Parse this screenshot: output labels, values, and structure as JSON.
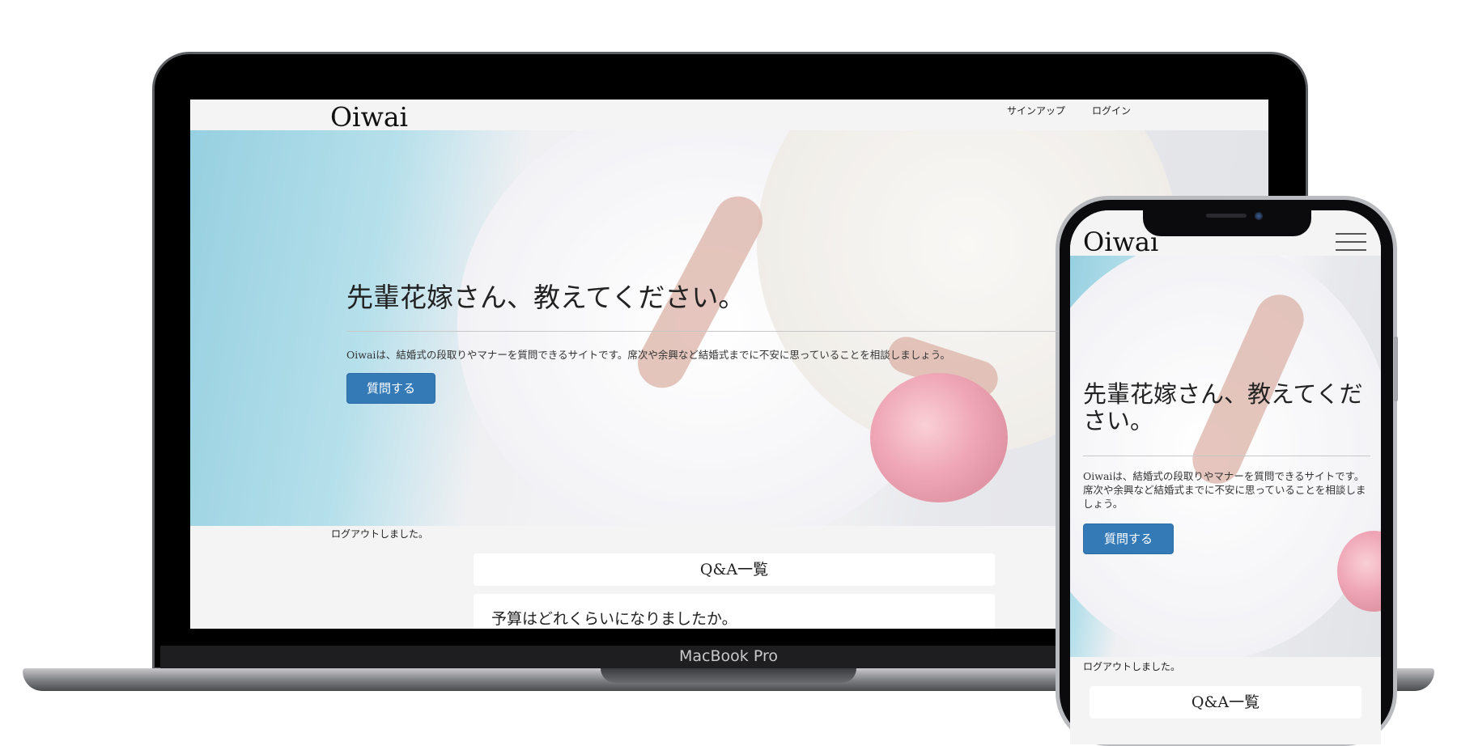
{
  "laptop": {
    "brand": "MacBook Pro",
    "site": {
      "logo": "Oiwai",
      "nav": {
        "signup": "サインアップ",
        "login": "ログイン"
      },
      "hero": {
        "title": "先輩花嫁さん、教えてください。",
        "text": "Oiwaiは、結婚式の段取りやマナーを質問できるサイトです。席次や余興など結婚式までに不安に思っていることを相談しましょう。",
        "button": "質問する"
      },
      "flash": "ログアウトしました。",
      "qa_heading": "Q&A一覧",
      "qa_first_item": "予算はどれくらいになりましたか。"
    }
  },
  "phone": {
    "site": {
      "logo": "Oiwai",
      "menu_icon": "hamburger-menu-icon",
      "hero": {
        "title": "先輩花嫁さん、教えてください。",
        "text": "Oiwaiは、結婚式の段取りやマナーを質問できるサイトです。席次や余興など結婚式までに不安に思っていることを相談しましょう。",
        "button": "質問する"
      },
      "flash": "ログアウトしました。",
      "qa_heading": "Q&A一覧"
    }
  },
  "colors": {
    "primary_button": "#337ab7",
    "background": "#f4f4f4"
  }
}
